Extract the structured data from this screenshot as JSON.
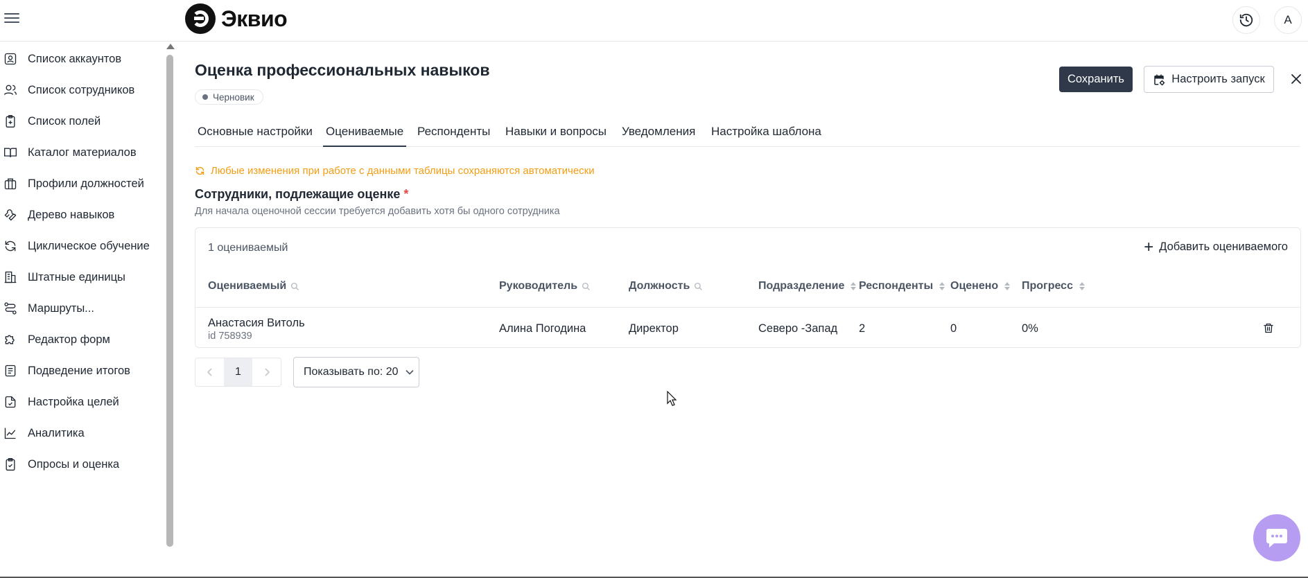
{
  "app": {
    "logo_text": "Эквио",
    "avatar_letter": "А"
  },
  "sidebar": {
    "items": [
      {
        "label": "Список аккаунтов",
        "icon": "account-list-icon"
      },
      {
        "label": "Список сотрудников",
        "icon": "users-icon"
      },
      {
        "label": "Список полей",
        "icon": "clipboard-icon"
      },
      {
        "label": "Каталог материалов",
        "icon": "book-icon"
      },
      {
        "label": "Профили должностей",
        "icon": "briefcase-icon"
      },
      {
        "label": "Дерево навыков",
        "icon": "wrench-icon"
      },
      {
        "label": "Циклическое обучение",
        "icon": "refresh-icon"
      },
      {
        "label": "Штатные единицы",
        "icon": "building-icon"
      },
      {
        "label": "Маршруты...",
        "icon": "route-icon"
      },
      {
        "label": "Редактор форм",
        "icon": "puzzle-icon"
      },
      {
        "label": "Подведение итогов",
        "icon": "report-icon"
      },
      {
        "label": "Настройка целей",
        "icon": "target-doc-icon"
      },
      {
        "label": "Аналитика",
        "icon": "chart-line-icon"
      },
      {
        "label": "Опросы и оценка",
        "icon": "survey-icon"
      }
    ]
  },
  "page": {
    "title": "Оценка профессиональных навыков",
    "status": "Черновик",
    "save_label": "Сохранить",
    "launch_label": "Настроить запуск"
  },
  "tabs": [
    {
      "label": "Основные настройки",
      "active": false
    },
    {
      "label": "Оцениваемые",
      "active": true
    },
    {
      "label": "Респонденты",
      "active": false
    },
    {
      "label": "Навыки и вопросы",
      "active": false
    },
    {
      "label": "Уведомления",
      "active": false
    },
    {
      "label": "Настройка шаблона",
      "active": false
    }
  ],
  "notice": {
    "autosave": "Любые изменения при работе с данными таблицы сохраняются автоматически",
    "color": "#f29d13"
  },
  "section": {
    "title": "Сотрудники, подлежащие оценке",
    "required_mark": "*",
    "hint": "Для начала оценочной сессии требуется добавить хотя бы одного сотрудника"
  },
  "table": {
    "count_label": "1 оцениваемый",
    "add_label": "Добавить оцениваемого",
    "columns": [
      "Оцениваемый",
      "Руководитель",
      "Должность",
      "Подразделение",
      "Респонденты",
      "Оценено",
      "Прогресс"
    ],
    "rows": [
      {
        "name": "Анастасия Витоль",
        "id": "id 758939",
        "manager": "Алина Погодина",
        "position": "Директор",
        "department": "Северо -Запад",
        "respondents": "2",
        "evaluated": "0",
        "progress": "0%"
      }
    ]
  },
  "pagination": {
    "current_page": "1",
    "page_size_label": "Показывать по: 20"
  },
  "colors": {
    "primary": "#2f3949",
    "chat": "#b69df2",
    "required": "#e5484d"
  }
}
